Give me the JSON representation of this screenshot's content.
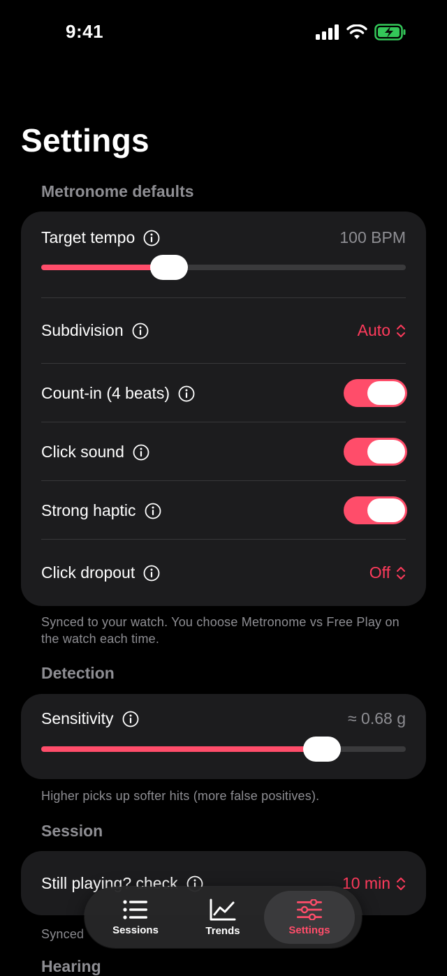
{
  "status_bar": {
    "time": "9:41"
  },
  "page_title": "Settings",
  "sections": {
    "metronome": {
      "header": "Metronome defaults",
      "target_tempo": {
        "label": "Target tempo",
        "value": "100 BPM",
        "slider_fraction": 0.35
      },
      "subdivision": {
        "label": "Subdivision",
        "value": "Auto"
      },
      "count_in": {
        "label": "Count-in (4 beats)",
        "on": true
      },
      "click_sound": {
        "label": "Click sound",
        "on": true
      },
      "strong_haptic": {
        "label": "Strong haptic",
        "on": true
      },
      "click_dropout": {
        "label": "Click dropout",
        "value": "Off"
      },
      "footnote": "Synced to your watch. You choose Metronome vs Free Play on the watch each time."
    },
    "detection": {
      "header": "Detection",
      "sensitivity": {
        "label": "Sensitivity",
        "value": "≈ 0.68 g",
        "slider_fraction": 0.77
      },
      "footnote": "Higher picks up softer hits (more false positives)."
    },
    "session": {
      "header": "Session",
      "still_playing": {
        "label": "Still playing? check",
        "value": "10 min"
      },
      "footnote": "Synced"
    },
    "hearing": {
      "header": "Hearing"
    }
  },
  "tabbar": {
    "tabs": [
      {
        "label": "Sessions",
        "icon": "list-icon",
        "active": false
      },
      {
        "label": "Trends",
        "icon": "chart-icon",
        "active": false
      },
      {
        "label": "Settings",
        "icon": "sliders-icon",
        "active": true
      }
    ]
  },
  "colors": {
    "accent": "#ff4d6a",
    "card": "#1c1c1e",
    "secondary_text": "#8e8e93"
  }
}
